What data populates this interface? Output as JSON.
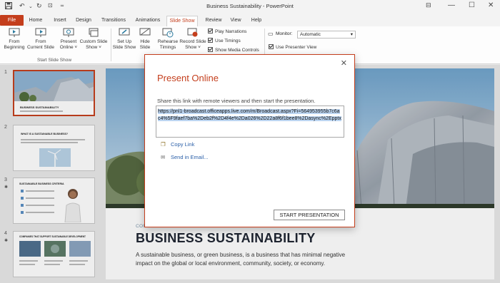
{
  "window": {
    "title": "Business Sustainability  -  PowerPoint"
  },
  "tabs": [
    {
      "label": "File"
    },
    {
      "label": "Home"
    },
    {
      "label": "Insert"
    },
    {
      "label": "Design"
    },
    {
      "label": "Transitions"
    },
    {
      "label": "Animations"
    },
    {
      "label": "Slide Show"
    },
    {
      "label": "Review"
    },
    {
      "label": "View"
    },
    {
      "label": "Help"
    }
  ],
  "ribbon": {
    "from_beginning": "From\nBeginning",
    "from_current": "From\nCurrent Slide",
    "present_online": "Present\nOnline ˅",
    "custom_show": "Custom Slide\nShow ˅",
    "group_start": "Start Slide Show",
    "setup_show": "Set Up\nSlide Show",
    "hide_slide": "Hide\nSlide",
    "rehearse": "Rehearse\nTimings",
    "record": "Record Slide\nShow ˅",
    "play_narrations": "Play Narrations",
    "use_timings": "Use Timings",
    "show_media": "Show Media Controls",
    "monitor_label": "Monitor:",
    "monitor_value": "Automatic",
    "use_presenter": "Use Presenter View"
  },
  "thumbnails": [
    {
      "num": "1",
      "title": "BUSINESS SUSTAINABILITY"
    },
    {
      "num": "2",
      "title": "WHAT IS A SUSTAINABLE BUSINESS?"
    },
    {
      "num": "3",
      "star": "✱",
      "title": "SUSTAINABLE BUSINESS CRITERIA"
    },
    {
      "num": "4",
      "star": "✱",
      "title": "COMPANIES THAT SUPPORT SUSTAINABLE DEVELOPMENT"
    }
  ],
  "slide": {
    "kicker": "CORPORATE ENVIRONMENTAL RESPONSIBILITY COUNCIL",
    "title": "BUSINESS SUSTAINABILITY",
    "description": "A sustainable business, or green business, is a business that has minimal negative impact on the global or local environment, community, society, or economy."
  },
  "dialog": {
    "title": "Present Online",
    "instruction": "Share this link with remote viewers and then start the presentation.",
    "link": "https://pnl1-broadcast.officeapps.live.com/m/Broadcast.aspx?Fi=564953955b7c6ac4%5F9faef7ba%2Deb2f%2D4f4e%2Da026%2D22a8f6f1bee8%2Dasync%2Epptx",
    "copy_link": "Copy Link",
    "send_email": "Send in Email...",
    "start_button": "START PRESENTATION",
    "close": "✕"
  },
  "colors": {
    "accent": "#c43e1c",
    "link": "#2a5fa8"
  }
}
